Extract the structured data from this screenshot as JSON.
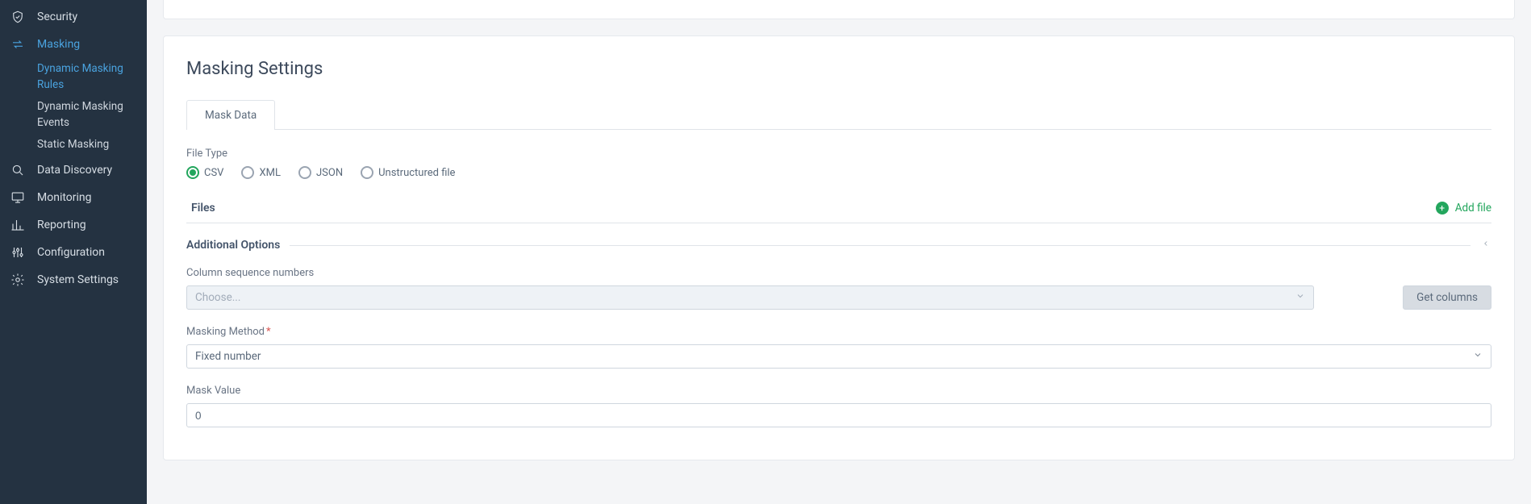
{
  "sidebar": {
    "items": [
      {
        "label": "Security",
        "icon": "shield"
      },
      {
        "label": "Masking",
        "icon": "swap",
        "active": true,
        "sub": [
          {
            "label": "Dynamic Masking Rules",
            "active": true
          },
          {
            "label": "Dynamic Masking Events"
          },
          {
            "label": "Static Masking"
          }
        ]
      },
      {
        "label": "Data Discovery",
        "icon": "search"
      },
      {
        "label": "Monitoring",
        "icon": "monitor"
      },
      {
        "label": "Reporting",
        "icon": "barchart"
      },
      {
        "label": "Configuration",
        "icon": "sliders"
      },
      {
        "label": "System Settings",
        "icon": "gear"
      }
    ]
  },
  "page": {
    "title": "Masking Settings",
    "tab": "Mask Data",
    "fileTypeLabel": "File Type",
    "fileTypes": {
      "csv": "CSV",
      "xml": "XML",
      "json": "JSON",
      "unstructured": "Unstructured file",
      "selected": "csv"
    },
    "filesLabel": "Files",
    "addFile": "Add file",
    "additionalOptions": "Additional Options",
    "colSeqLabel": "Column sequence numbers",
    "colSeqPlaceholder": "Choose...",
    "getColumns": "Get columns",
    "maskingMethodLabel": "Masking Method",
    "maskingMethodValue": "Fixed number",
    "maskValueLabel": "Mask Value",
    "maskValue": "0"
  }
}
